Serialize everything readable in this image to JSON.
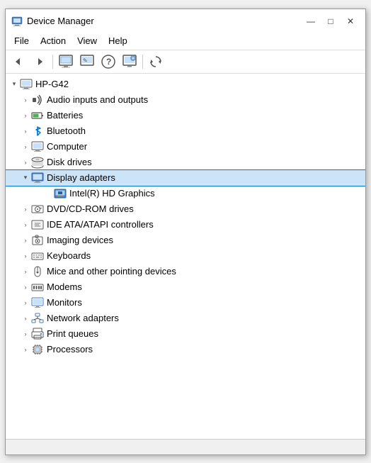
{
  "window": {
    "title": "Device Manager",
    "title_icon": "device-manager",
    "controls": {
      "minimize": "—",
      "maximize": "□",
      "close": "✕"
    }
  },
  "menu": {
    "items": [
      "File",
      "Action",
      "View",
      "Help"
    ]
  },
  "toolbar": {
    "buttons": [
      "←",
      "→",
      "⊟",
      "⊞",
      "?",
      "⊡",
      "⟳"
    ]
  },
  "tree": {
    "root": {
      "label": "HP-G42",
      "expanded": true,
      "children": [
        {
          "id": "audio",
          "label": "Audio inputs and outputs",
          "icon": "audio",
          "expanded": false,
          "indent": 1
        },
        {
          "id": "batteries",
          "label": "Batteries",
          "icon": "battery",
          "expanded": false,
          "indent": 1
        },
        {
          "id": "bluetooth",
          "label": "Bluetooth",
          "icon": "bluetooth",
          "expanded": false,
          "indent": 1
        },
        {
          "id": "computer",
          "label": "Computer",
          "icon": "computer",
          "expanded": false,
          "indent": 1
        },
        {
          "id": "disk",
          "label": "Disk drives",
          "icon": "disk",
          "expanded": false,
          "indent": 1
        },
        {
          "id": "display",
          "label": "Display adapters",
          "icon": "display",
          "expanded": true,
          "indent": 1,
          "selected": true
        },
        {
          "id": "intel",
          "label": "Intel(R) HD Graphics",
          "icon": "gpu",
          "expanded": false,
          "indent": 2,
          "child": true
        },
        {
          "id": "dvd",
          "label": "DVD/CD-ROM drives",
          "icon": "dvd",
          "expanded": false,
          "indent": 1
        },
        {
          "id": "ide",
          "label": "IDE ATA/ATAPI controllers",
          "icon": "ide",
          "expanded": false,
          "indent": 1
        },
        {
          "id": "imaging",
          "label": "Imaging devices",
          "icon": "imaging",
          "expanded": false,
          "indent": 1
        },
        {
          "id": "keyboards",
          "label": "Keyboards",
          "icon": "keyboard",
          "expanded": false,
          "indent": 1
        },
        {
          "id": "mice",
          "label": "Mice and other pointing devices",
          "icon": "mouse",
          "expanded": false,
          "indent": 1
        },
        {
          "id": "modems",
          "label": "Modems",
          "icon": "modem",
          "expanded": false,
          "indent": 1
        },
        {
          "id": "monitors",
          "label": "Monitors",
          "icon": "monitor",
          "expanded": false,
          "indent": 1
        },
        {
          "id": "network",
          "label": "Network adapters",
          "icon": "network",
          "expanded": false,
          "indent": 1
        },
        {
          "id": "print",
          "label": "Print queues",
          "icon": "printer",
          "expanded": false,
          "indent": 1
        },
        {
          "id": "processors",
          "label": "Processors",
          "icon": "processor",
          "expanded": false,
          "indent": 1
        }
      ]
    }
  },
  "status": ""
}
